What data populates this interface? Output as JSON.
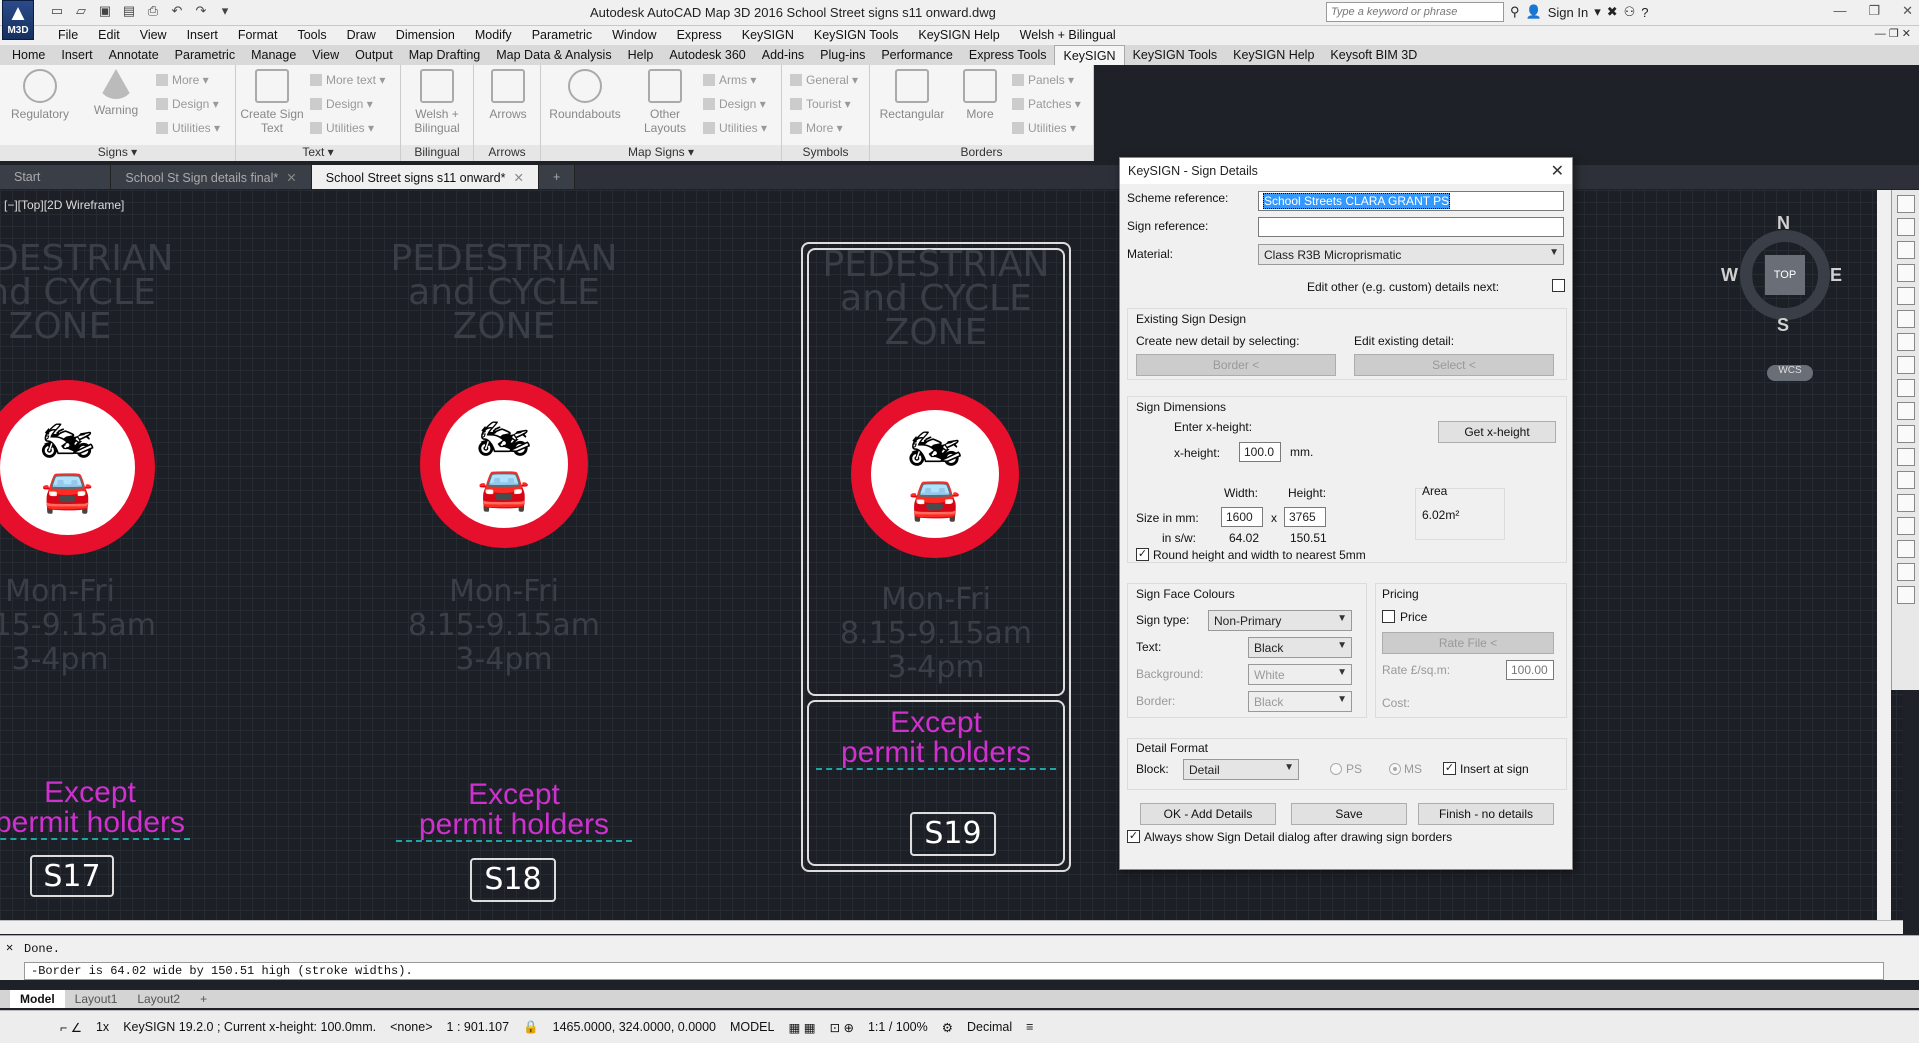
{
  "app": {
    "title": "Autodesk AutoCAD Map 3D 2016    School Street signs s11 onward.dwg",
    "logo": "M3D",
    "search_placeholder": "Type a keyword or phrase",
    "signin": "Sign In"
  },
  "menus": [
    "File",
    "Edit",
    "View",
    "Insert",
    "Format",
    "Tools",
    "Draw",
    "Dimension",
    "Modify",
    "Parametric",
    "Window",
    "Express",
    "KeySIGN",
    "KeySIGN Tools",
    "KeySIGN Help",
    "Welsh + Bilingual"
  ],
  "ribbon_tabs": [
    "Home",
    "Insert",
    "Annotate",
    "Parametric",
    "Manage",
    "View",
    "Output",
    "Map Drafting",
    "Map Data & Analysis",
    "Help",
    "Autodesk 360",
    "Add-ins",
    "Plug-ins",
    "Performance",
    "Express Tools",
    "KeySIGN",
    "KeySIGN Tools",
    "KeySIGN Help",
    "Keysoft BIM 3D"
  ],
  "ribbon": {
    "signs": {
      "title": "Signs",
      "regulatory": "Regulatory",
      "warning": "Warning",
      "more": "More",
      "design": "Design",
      "utilities": "Utilities"
    },
    "text": {
      "title": "Text",
      "create": "Create Sign Text",
      "more": "More text",
      "design": "Design",
      "utilities": "Utilities"
    },
    "bilingual": {
      "title": "Bilingual",
      "welsh": "Welsh + Bilingual"
    },
    "arrows": {
      "title": "Arrows",
      "arrows": "Arrows"
    },
    "mapsigns": {
      "title": "Map Signs",
      "roundabouts": "Roundabouts",
      "other": "Other Layouts",
      "arms": "Arms",
      "design": "Design",
      "utilities": "Utilities"
    },
    "symbols": {
      "title": "Symbols",
      "general": "General",
      "tourist": "Tourist",
      "more": "More"
    },
    "borders": {
      "title": "Borders",
      "rectangular": "Rectangular",
      "more": "More",
      "panels": "Panels",
      "patches": "Patches",
      "utilities": "Utilities"
    }
  },
  "doc_tabs": [
    "Start",
    "School St Sign details final*",
    "School Street signs s11 onward*"
  ],
  "viewport": {
    "label": "[−][Top][2D Wireframe]",
    "ghost_lines": [
      "PEDESTRIAN",
      "and CYCLE",
      "ZONE"
    ],
    "times": [
      "Mon-Fri",
      "8.15-9.15am",
      "3-4pm"
    ],
    "except": [
      "Except",
      "permit holders"
    ],
    "codes": [
      "S17",
      "S18",
      "S19"
    ],
    "compass": {
      "n": "N",
      "s": "S",
      "e": "E",
      "w": "W",
      "top": "TOP",
      "wcs": "WCS"
    }
  },
  "dialog": {
    "title": "KeySIGN - Sign Details",
    "scheme_label": "Scheme reference:",
    "scheme_value": "School Streets CLARA GRANT PS",
    "signref_label": "Sign reference:",
    "signref_value": "",
    "material_label": "Material:",
    "material_value": "Class R3B Microprismatic",
    "edit_other": "Edit other (e.g. custom) details next:",
    "existing": {
      "title": "Existing Sign Design",
      "create": "Create new detail by selecting:",
      "edit": "Edit existing detail:",
      "border_btn": "Border <",
      "select_btn": "Select <"
    },
    "dims": {
      "title": "Sign Dimensions",
      "enter": "Enter x-height:",
      "get": "Get x-height",
      "xh_label": "x-height:",
      "xh_value": "100.0",
      "mm": "mm.",
      "width": "Width:",
      "height": "Height:",
      "size_label": "Size in mm:",
      "w_value": "1600",
      "x": "x",
      "h_value": "3765",
      "sw_label": "in s/w:",
      "sw_w": "64.02",
      "sw_h": "150.51",
      "area_label": "Area",
      "area_value": "6.02m²",
      "round": "Round height and width to nearest 5mm"
    },
    "colours": {
      "title": "Sign Face Colours",
      "type_label": "Sign type:",
      "type_value": "Non-Primary",
      "text_label": "Text:",
      "text_value": "Black",
      "bg_label": "Background:",
      "bg_value": "White",
      "border_label": "Border:",
      "border_value": "Black"
    },
    "pricing": {
      "title": "Pricing",
      "price": "Price",
      "rate_file": "Rate File <",
      "rate_label": "Rate £/sq.m:",
      "rate_value": "100.00",
      "cost": "Cost:"
    },
    "format": {
      "title": "Detail Format",
      "block_label": "Block:",
      "block_value": "Detail",
      "ps": "PS",
      "ms": "MS",
      "insert": "Insert at sign"
    },
    "ok": "OK - Add Details",
    "save": "Save",
    "finish": "Finish - no details",
    "always": "Always show Sign Detail dialog after drawing sign borders"
  },
  "command": {
    "line1": "Done.",
    "line2": "-Border is 64.02 wide by 150.51 high (stroke widths)."
  },
  "layout_tabs": [
    "Model",
    "Layout1",
    "Layout2"
  ],
  "status": {
    "keysign": "KeySIGN 19.2.0 ;  Current x-height: 100.0mm.",
    "none": "<none>",
    "scale": "1 : 901.107",
    "coords": "1465.0000, 324.0000, 0.0000",
    "model": "MODEL",
    "annoscale": "1:1 / 100%",
    "units": "Decimal",
    "zoom": "1x"
  }
}
